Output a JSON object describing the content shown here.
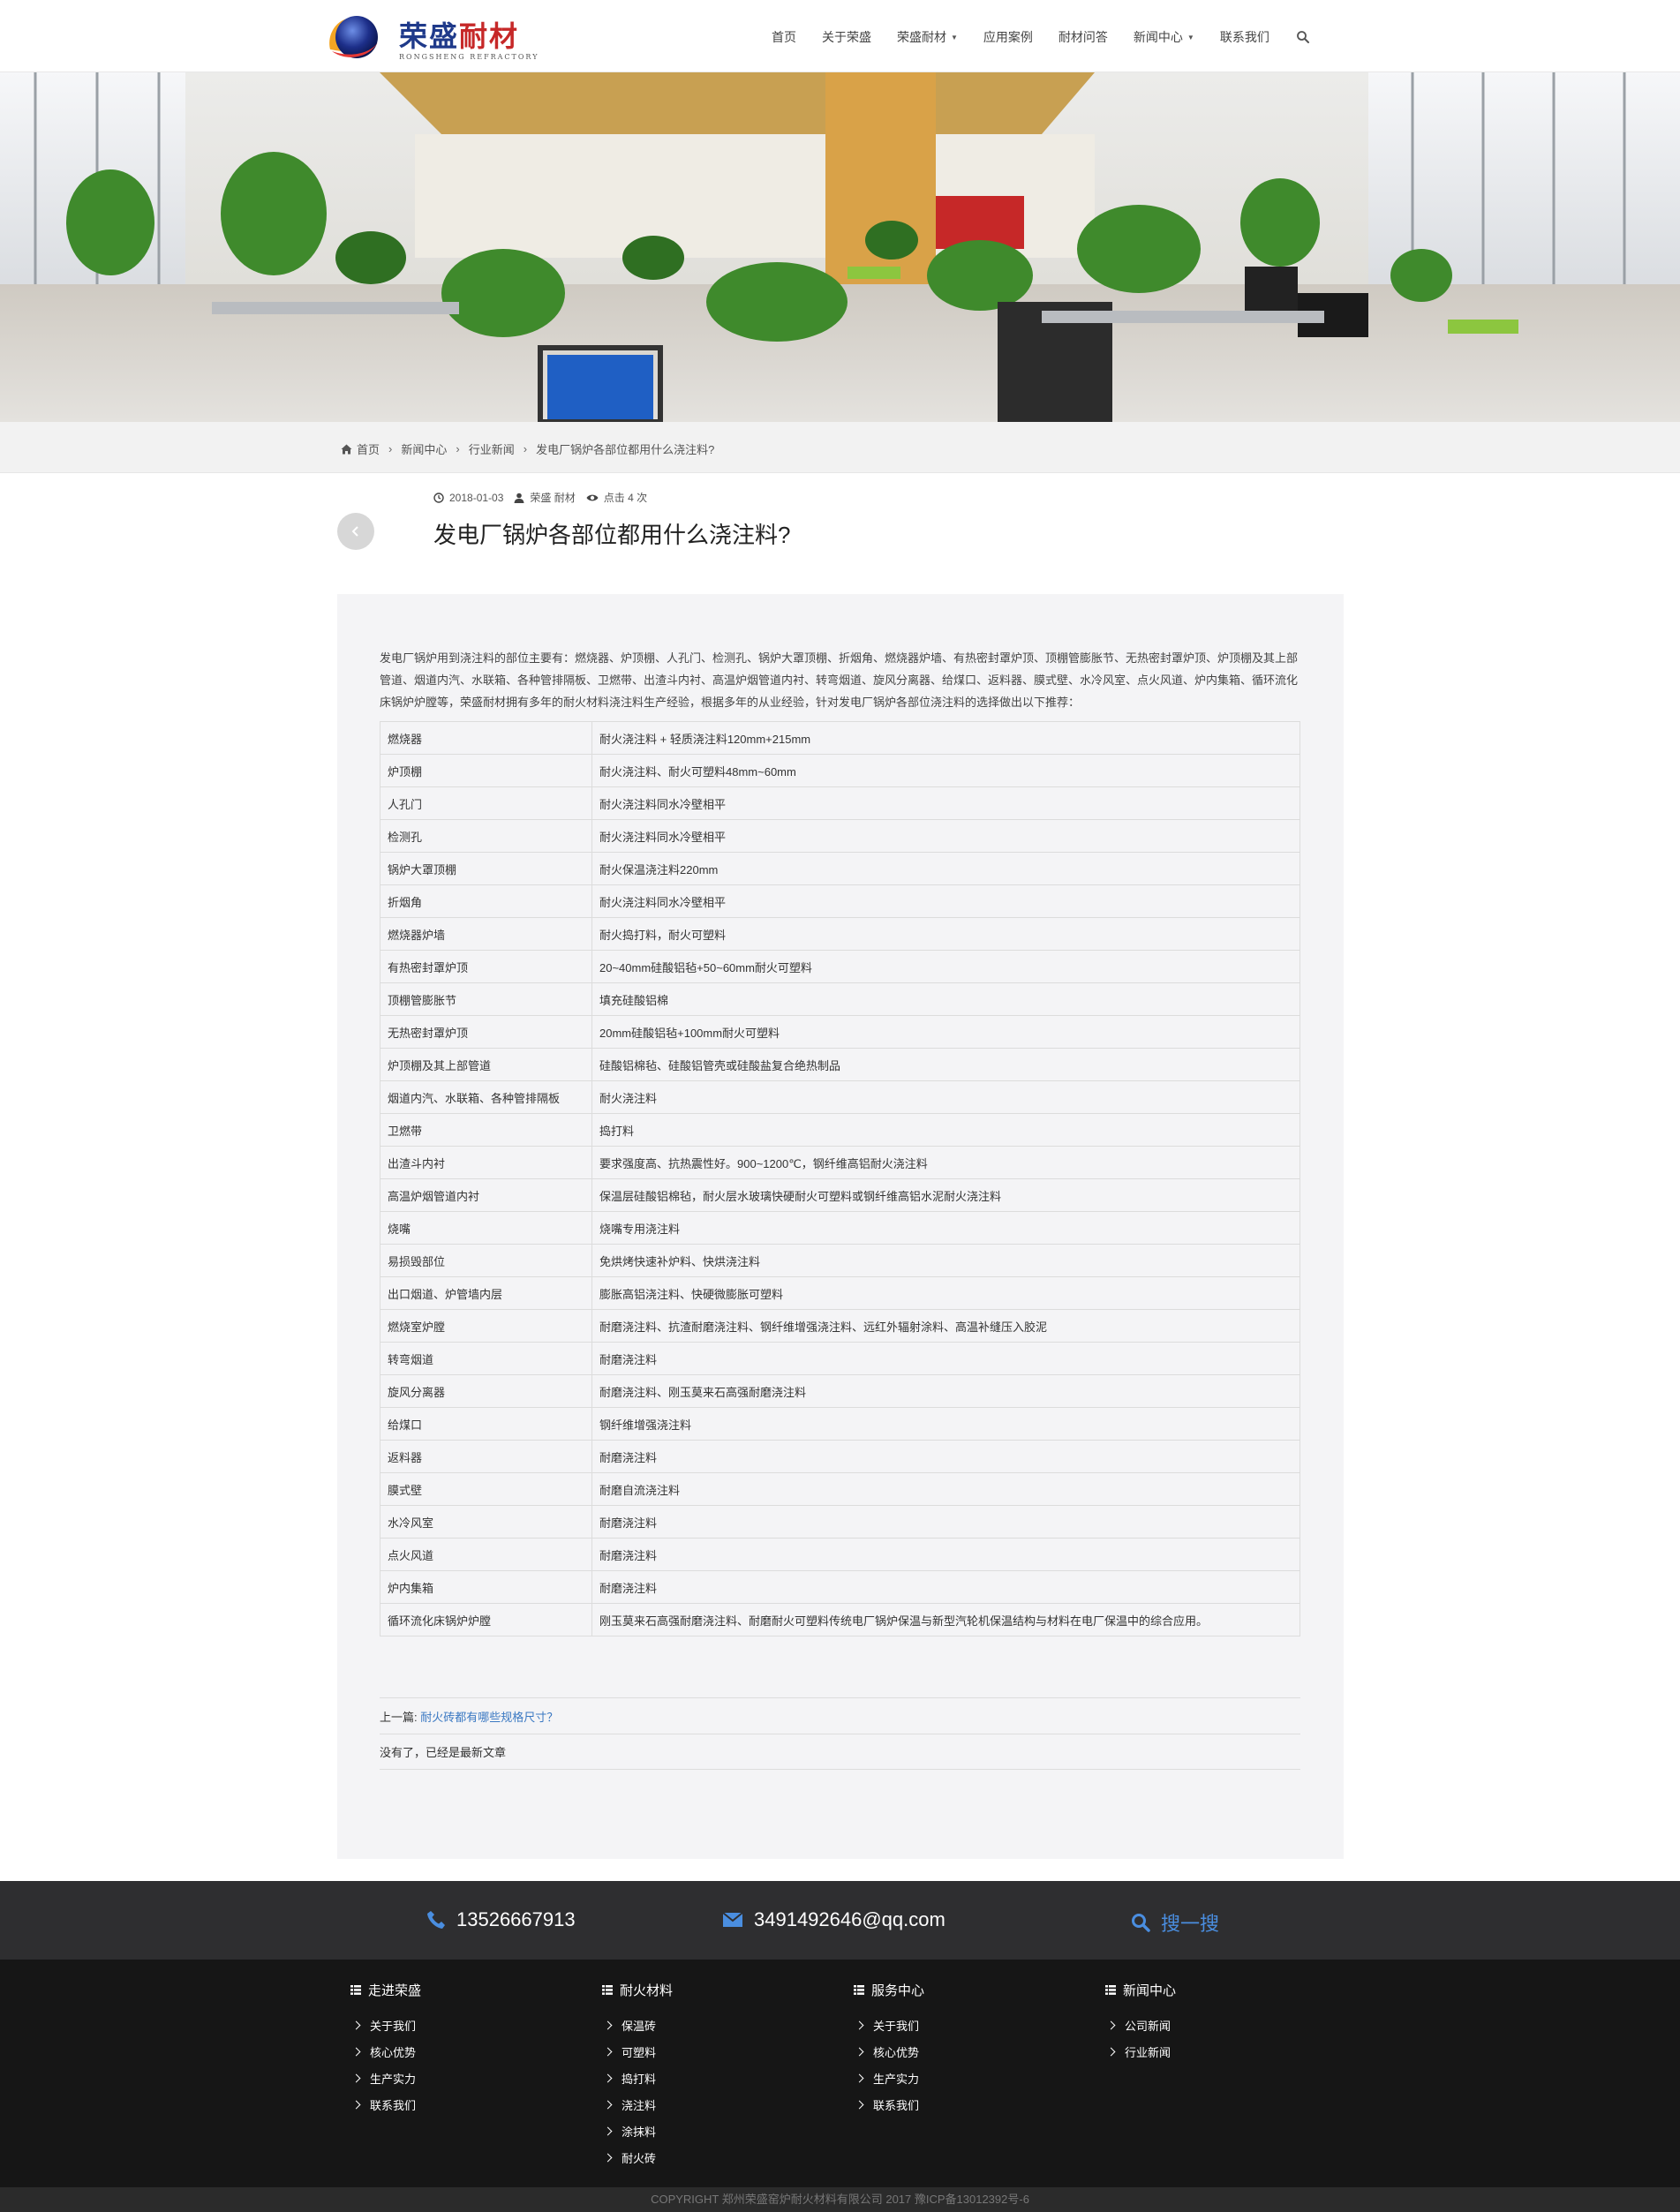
{
  "header": {
    "logo_cn_1": "荣盛",
    "logo_cn_2": "耐材",
    "logo_en": "RONGSHENG REFRACTORY",
    "nav": [
      {
        "label": "首页"
      },
      {
        "label": "关于荣盛"
      },
      {
        "label": "荣盛耐材"
      },
      {
        "label": "应用案例"
      },
      {
        "label": "耐材问答"
      },
      {
        "label": "新闻中心"
      },
      {
        "label": "联系我们"
      }
    ]
  },
  "breadcrumb": {
    "items": [
      "首页",
      "新闻中心",
      "行业新闻",
      "发电厂锅炉各部位都用什么浇注料?"
    ]
  },
  "article": {
    "date": "2018-01-03",
    "author": "荣盛 耐材",
    "views": "点击 4 次",
    "title": "发电厂锅炉各部位都用什么浇注料?",
    "intro": "发电厂锅炉用到浇注料的部位主要有：燃烧器、炉顶棚、人孔门、检测孔、锅炉大罩顶棚、折烟角、燃烧器炉墙、有热密封罩炉顶、顶棚管膨胀节、无热密封罩炉顶、炉顶棚及其上部管道、烟道内汽、水联箱、各种管排隔板、卫燃带、出渣斗内衬、高温炉烟管道内衬、转弯烟道、旋风分离器、给煤口、返料器、膜式壁、水冷风室、点火风道、炉内集箱、循环流化床锅炉炉膛等，荣盛耐材拥有多年的耐火材料浇注料生产经验，根据多年的从业经验，针对发电厂锅炉各部位浇注料的选择做出以下推荐：",
    "table": [
      [
        "燃烧器",
        "耐火浇注料 + 轻质浇注料120mm+215mm"
      ],
      [
        "炉顶棚",
        "耐火浇注料、耐火可塑料48mm~60mm"
      ],
      [
        "人孔门",
        "耐火浇注料同水冷壁相平"
      ],
      [
        "检测孔",
        "耐火浇注料同水冷壁相平"
      ],
      [
        "锅炉大罩顶棚",
        "耐火保温浇注料220mm"
      ],
      [
        "折烟角",
        "耐火浇注料同水冷壁相平"
      ],
      [
        "燃烧器炉墙",
        "耐火捣打料，耐火可塑料"
      ],
      [
        "有热密封罩炉顶",
        "20~40mm硅酸铝毡+50~60mm耐火可塑料"
      ],
      [
        "顶棚管膨胀节",
        "填充硅酸铝棉"
      ],
      [
        "无热密封罩炉顶",
        "20mm硅酸铝毡+100mm耐火可塑料"
      ],
      [
        "炉顶棚及其上部管道",
        "硅酸铝棉毡、硅酸铝管壳或硅酸盐复合绝热制品"
      ],
      [
        "烟道内汽、水联箱、各种管排隔板",
        "耐火浇注料"
      ],
      [
        "卫燃带",
        "捣打料"
      ],
      [
        "出渣斗内衬",
        "要求强度高、抗热震性好。900~1200℃，钢纤维高铝耐火浇注料"
      ],
      [
        "高温炉烟管道内衬",
        "保温层硅酸铝棉毡，耐火层水玻璃快硬耐火可塑料或钢纤维高铝水泥耐火浇注料"
      ],
      [
        "烧嘴",
        "烧嘴专用浇注料"
      ],
      [
        "易损毁部位",
        "免烘烤快速补炉料、快烘浇注料"
      ],
      [
        "出口烟道、炉管墙内层",
        "膨胀高铝浇注料、快硬微膨胀可塑料"
      ],
      [
        "燃烧室炉膛",
        "耐磨浇注料、抗渣耐磨浇注料、钢纤维增强浇注料、远红外辐射涂料、高温补缝压入胶泥"
      ],
      [
        "转弯烟道",
        "耐磨浇注料"
      ],
      [
        "旋风分离器",
        "耐磨浇注料、刚玉莫来石高强耐磨浇注料"
      ],
      [
        "给煤口",
        "钢纤维增强浇注料"
      ],
      [
        "返料器",
        "耐磨浇注料"
      ],
      [
        "膜式壁",
        "耐磨自流浇注料"
      ],
      [
        "水冷风室",
        "耐磨浇注料"
      ],
      [
        "点火风道",
        "耐磨浇注料"
      ],
      [
        "炉内集箱",
        "耐磨浇注料"
      ],
      [
        "循环流化床锅炉炉膛",
        "刚玉莫来石高强耐磨浇注料、耐磨耐火可塑料传统电厂锅炉保温与新型汽轮机保温结构与材料在电厂保温中的综合应用。"
      ]
    ],
    "prev_label": "上一篇:",
    "prev_link": "耐火砖都有哪些规格尺寸？",
    "next_text": "没有了，已经是最新文章"
  },
  "contact": {
    "phone": "13526667913",
    "email": "3491492646@qq.com",
    "search": "搜一搜"
  },
  "footer": {
    "columns": [
      {
        "title": "走进荣盛",
        "items": [
          "关于我们",
          "核心优势",
          "生产实力",
          "联系我们"
        ]
      },
      {
        "title": "耐火材料",
        "items": [
          "保温砖",
          "可塑料",
          "捣打料",
          "浇注料",
          "涂抹料",
          "耐火砖"
        ]
      },
      {
        "title": "服务中心",
        "items": [
          "关于我们",
          "核心优势",
          "生产实力",
          "联系我们"
        ]
      },
      {
        "title": "新闻中心",
        "items": [
          "公司新闻",
          "行业新闻"
        ]
      }
    ],
    "copyright": "COPYRIGHT 郑州荣盛窑炉耐火材料有限公司 2017 豫ICP备13012392号-6"
  }
}
